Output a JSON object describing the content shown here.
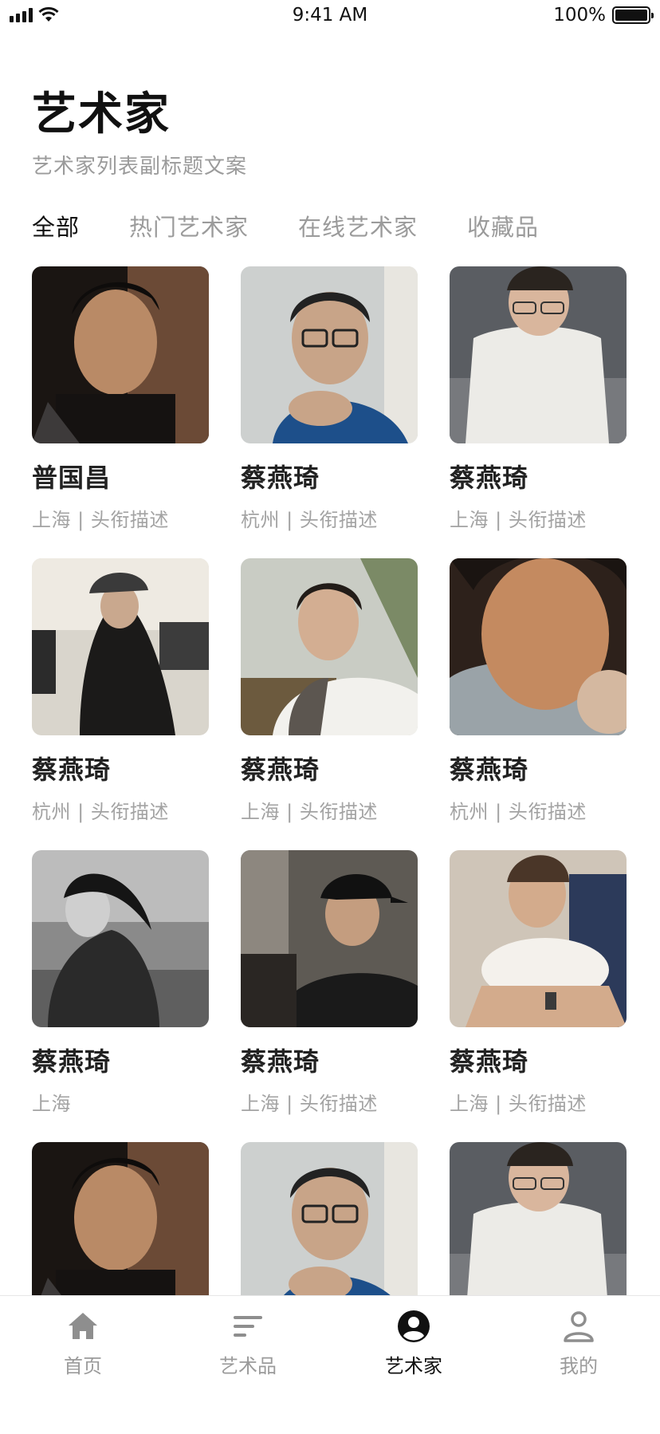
{
  "status_bar": {
    "time": "9:41 AM",
    "battery": "100%",
    "battery_level": 1.0
  },
  "header": {
    "title": "艺术家",
    "subtitle": "艺术家列表副标题文案"
  },
  "tabs": [
    {
      "label": "全部",
      "active": true
    },
    {
      "label": "热门艺术家",
      "active": false
    },
    {
      "label": "在线艺术家",
      "active": false
    },
    {
      "label": "收藏品",
      "active": false
    }
  ],
  "artists": [
    {
      "name": "普国昌",
      "desc": "上海 | 头衔描述",
      "photo": "man-dark-tanktop"
    },
    {
      "name": "蔡燕琦",
      "desc": "杭州 | 头衔描述",
      "photo": "man-glasses-blue"
    },
    {
      "name": "蔡燕琦",
      "desc": "上海 | 头衔描述",
      "photo": "man-white-tee"
    },
    {
      "name": "蔡燕琦",
      "desc": "杭州 | 头衔描述",
      "photo": "woman-street"
    },
    {
      "name": "蔡燕琦",
      "desc": "上海 | 头衔描述",
      "photo": "man-towel"
    },
    {
      "name": "蔡燕琦",
      "desc": "杭州 | 头衔描述",
      "photo": "man-closeup"
    },
    {
      "name": "蔡燕琦",
      "desc": "上海",
      "photo": "woman-beach-bw"
    },
    {
      "name": "蔡燕琦",
      "desc": "上海 | 头衔描述",
      "photo": "man-cap"
    },
    {
      "name": "蔡燕琦",
      "desc": "上海 | 头衔描述",
      "photo": "man-cat"
    },
    {
      "name": "",
      "desc": "",
      "photo": "man-dark-tanktop"
    },
    {
      "name": "",
      "desc": "",
      "photo": "man-glasses-blue"
    },
    {
      "name": "",
      "desc": "",
      "photo": "man-white-tee"
    }
  ],
  "tabbar": [
    {
      "label": "首页",
      "icon": "home-icon",
      "active": false
    },
    {
      "label": "艺术品",
      "icon": "list-icon",
      "active": false
    },
    {
      "label": "艺术家",
      "icon": "user-circle-icon",
      "active": true
    },
    {
      "label": "我的",
      "icon": "profile-icon",
      "active": false
    }
  ],
  "colors": {
    "text": "#111111",
    "muted": "#9b9b9b",
    "divider": "#e6e6e6"
  }
}
